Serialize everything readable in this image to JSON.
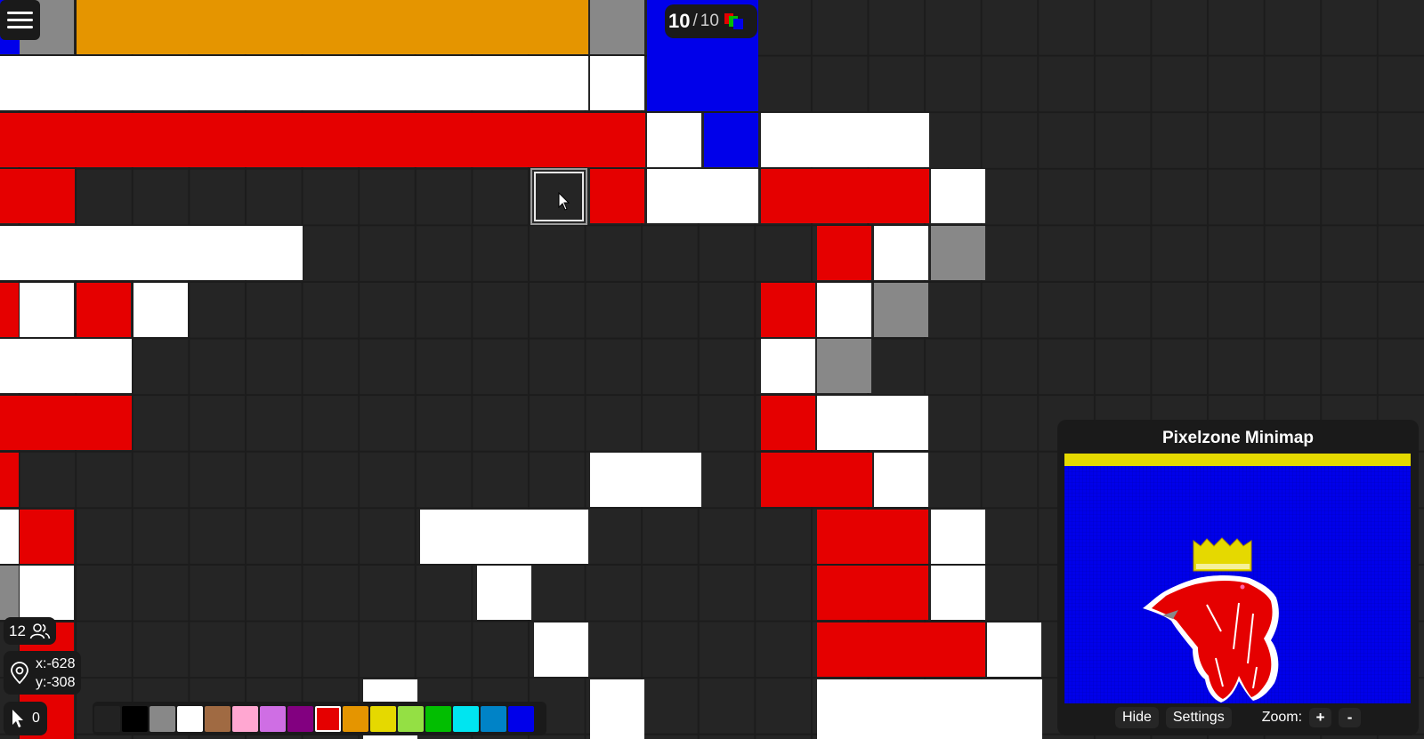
{
  "charges": {
    "current": "10",
    "separator": "/",
    "max": "10"
  },
  "online_count": "12",
  "coordinates": {
    "x": "x:-628",
    "y": "y:-308"
  },
  "cursor_count": "0",
  "palette": {
    "selected": "#e50000",
    "colors": [
      "#222222",
      "#000000",
      "#888888",
      "#ffffff",
      "#a06a42",
      "#ffa7d1",
      "#cf6ee4",
      "#820080",
      "#e50000",
      "#e59500",
      "#e5d900",
      "#94e044",
      "#02be01",
      "#00e5f0",
      "#0083c7",
      "#0000ea"
    ]
  },
  "minimap": {
    "title": "Pixelzone Minimap",
    "hide_label": "Hide",
    "settings_label": "Settings",
    "zoom_label": "Zoom:",
    "zoom_in": "+",
    "zoom_out": "-"
  },
  "icons": {
    "menu": "hamburger-icon",
    "online": "users-icon",
    "location": "location-pin-icon",
    "cursor": "cursor-icon",
    "charges": "stacked-squares-icon"
  }
}
